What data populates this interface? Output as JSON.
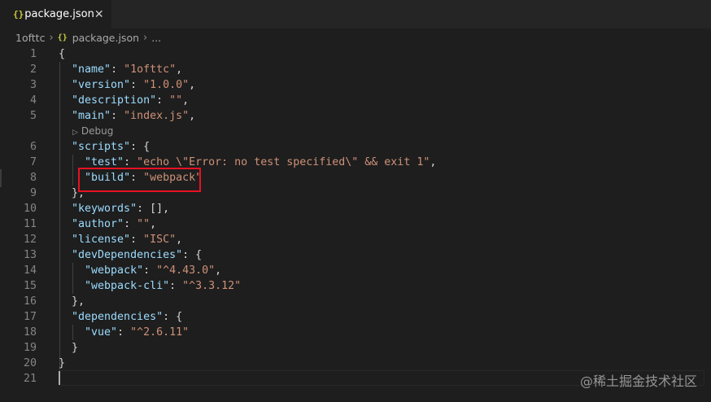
{
  "tab": {
    "icon": "{}",
    "label": "package.json",
    "close": "✕"
  },
  "breadcrumb": {
    "folder": "1ofttc",
    "file_icon": "{}",
    "file": "package.json",
    "more": "..."
  },
  "codelens": {
    "label": "Debug"
  },
  "watermark": "@稀土掘金技术社区",
  "lines": [
    {
      "n": "1",
      "code": [
        [
          "p",
          "{"
        ]
      ]
    },
    {
      "n": "2",
      "code": [
        [
          "p",
          "  "
        ],
        [
          "k",
          "\"name\""
        ],
        [
          "p",
          ": "
        ],
        [
          "s",
          "\"1ofttc\""
        ],
        [
          "p",
          ","
        ]
      ]
    },
    {
      "n": "3",
      "code": [
        [
          "p",
          "  "
        ],
        [
          "k",
          "\"version\""
        ],
        [
          "p",
          ": "
        ],
        [
          "s",
          "\"1.0.0\""
        ],
        [
          "p",
          ","
        ]
      ]
    },
    {
      "n": "4",
      "code": [
        [
          "p",
          "  "
        ],
        [
          "k",
          "\"description\""
        ],
        [
          "p",
          ": "
        ],
        [
          "s",
          "\"\""
        ],
        [
          "p",
          ","
        ]
      ]
    },
    {
      "n": "5",
      "code": [
        [
          "p",
          "  "
        ],
        [
          "k",
          "\"main\""
        ],
        [
          "p",
          ": "
        ],
        [
          "s",
          "\"index.js\""
        ],
        [
          "p",
          ","
        ]
      ]
    },
    {
      "n": "6",
      "code": [
        [
          "p",
          "  "
        ],
        [
          "k",
          "\"scripts\""
        ],
        [
          "p",
          ": {"
        ]
      ]
    },
    {
      "n": "7",
      "code": [
        [
          "p",
          "    "
        ],
        [
          "k",
          "\"test\""
        ],
        [
          "p",
          ": "
        ],
        [
          "s",
          "\"echo \\\"Error: no test specified\\\" && exit 1\""
        ],
        [
          "p",
          ","
        ]
      ]
    },
    {
      "n": "8",
      "code": [
        [
          "p",
          "    "
        ],
        [
          "k",
          "\"build\""
        ],
        [
          "p",
          ": "
        ],
        [
          "s",
          "\"webpack\""
        ]
      ]
    },
    {
      "n": "9",
      "code": [
        [
          "p",
          "  },"
        ]
      ]
    },
    {
      "n": "10",
      "code": [
        [
          "p",
          "  "
        ],
        [
          "k",
          "\"keywords\""
        ],
        [
          "p",
          ": [],"
        ]
      ]
    },
    {
      "n": "11",
      "code": [
        [
          "p",
          "  "
        ],
        [
          "k",
          "\"author\""
        ],
        [
          "p",
          ": "
        ],
        [
          "s",
          "\"\""
        ],
        [
          "p",
          ","
        ]
      ]
    },
    {
      "n": "12",
      "code": [
        [
          "p",
          "  "
        ],
        [
          "k",
          "\"license\""
        ],
        [
          "p",
          ": "
        ],
        [
          "s",
          "\"ISC\""
        ],
        [
          "p",
          ","
        ]
      ]
    },
    {
      "n": "13",
      "code": [
        [
          "p",
          "  "
        ],
        [
          "k",
          "\"devDependencies\""
        ],
        [
          "p",
          ": {"
        ]
      ]
    },
    {
      "n": "14",
      "code": [
        [
          "p",
          "    "
        ],
        [
          "k",
          "\"webpack\""
        ],
        [
          "p",
          ": "
        ],
        [
          "s",
          "\"^4.43.0\""
        ],
        [
          "p",
          ","
        ]
      ]
    },
    {
      "n": "15",
      "code": [
        [
          "p",
          "    "
        ],
        [
          "k",
          "\"webpack-cli\""
        ],
        [
          "p",
          ": "
        ],
        [
          "s",
          "\"^3.3.12\""
        ]
      ]
    },
    {
      "n": "16",
      "code": [
        [
          "p",
          "  },"
        ]
      ]
    },
    {
      "n": "17",
      "code": [
        [
          "p",
          "  "
        ],
        [
          "k",
          "\"dependencies\""
        ],
        [
          "p",
          ": {"
        ]
      ]
    },
    {
      "n": "18",
      "code": [
        [
          "p",
          "    "
        ],
        [
          "k",
          "\"vue\""
        ],
        [
          "p",
          ": "
        ],
        [
          "s",
          "\"^2.6.11\""
        ]
      ]
    },
    {
      "n": "19",
      "code": [
        [
          "p",
          "  }"
        ]
      ]
    },
    {
      "n": "20",
      "code": [
        [
          "p",
          "}"
        ]
      ]
    },
    {
      "n": "21",
      "code": []
    }
  ]
}
